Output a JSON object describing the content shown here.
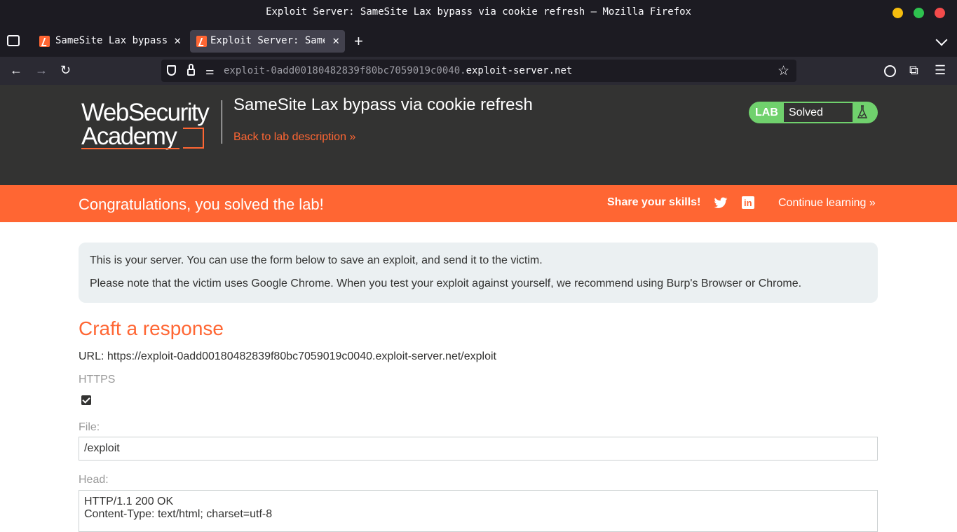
{
  "window": {
    "title": "Exploit Server: SameSite Lax bypass via cookie refresh — Mozilla Firefox"
  },
  "tabs": [
    {
      "label": "SameSite Lax bypass v",
      "active": false
    },
    {
      "label": "Exploit Server: SameS",
      "active": true
    }
  ],
  "navbar": {
    "url_prefix": "exploit-0add00180482839f80bc7059019c0040.",
    "url_domain": "exploit-server.net"
  },
  "header": {
    "logo_line1": "WebSecurity",
    "logo_line2": "Academy",
    "lab_title": "SameSite Lax bypass via cookie refresh",
    "back_link": "Back to lab description",
    "status_lab": "LAB",
    "status_value": "Solved"
  },
  "banner": {
    "message": "Congratulations, you solved the lab!",
    "share": "Share your skills!",
    "continue": "Continue learning"
  },
  "notice": {
    "line1": "This is your server. You can use the form below to save an exploit, and send it to the victim.",
    "line2": "Please note that the victim uses Google Chrome. When you test your exploit against yourself, we recommend using Burp's Browser or Chrome."
  },
  "form": {
    "heading": "Craft a response",
    "url_line": "URL: https://exploit-0add00180482839f80bc7059019c0040.exploit-server.net/exploit",
    "https_label": "HTTPS",
    "https_checked": true,
    "file_label": "File:",
    "file_value": "/exploit",
    "head_label": "Head:",
    "head_lines": [
      "HTTP/1.1 200 OK",
      "Content-Type: text/html; charset=utf-8"
    ]
  },
  "colors": {
    "accent": "#ff6633",
    "header_bg": "#333332",
    "solved_green": "#70d16d"
  }
}
